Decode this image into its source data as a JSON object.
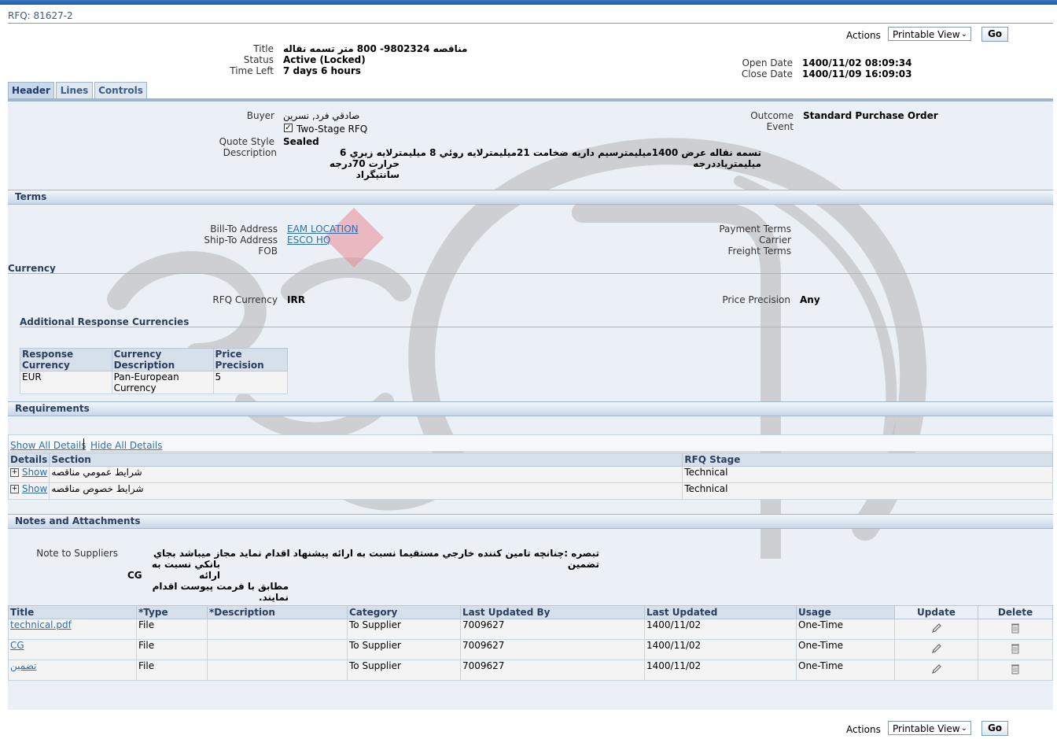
{
  "rfq_title": "RFQ: 81627-2",
  "actions": {
    "label": "Actions",
    "select_value": "Printable View",
    "go_label": "Go"
  },
  "summary": {
    "title_label": "Title",
    "title_value": "مناقصه 9802324- 800 متر تسمه نقاله",
    "status_label": "Status",
    "status_value": "Active (Locked)",
    "time_left_label": "Time Left",
    "time_left_value": "7 days 6 hours",
    "open_date_label": "Open Date",
    "open_date_value": "1400/11/02 08:09:34",
    "close_date_label": "Close Date",
    "close_date_value": "1400/11/09 16:09:03"
  },
  "tabs": [
    "Header",
    "Lines",
    "Controls"
  ],
  "header": {
    "buyer_label": "Buyer",
    "buyer_value": "صادقي فرد, نسرين",
    "two_stage_label": "Two-Stage RFQ",
    "quote_style_label": "Quote Style",
    "quote_style_value": "Sealed",
    "description_label": "Description",
    "description_line1": "تسمه نقاله عرض 1400ميليمترسيم داريه ضخامت 21ميليمترلايه روئي 8 ميليمترلايه زيري 6 ميليمترياددرجه",
    "description_line2": "حرارت 70درجه سانتيگراد",
    "outcome_label": "Outcome",
    "outcome_value": "Standard Purchase Order",
    "event_label": "Event"
  },
  "terms": {
    "section_title": "Terms",
    "bill_to_label": "Bill-To Address",
    "bill_to_value": "EAM LOCATION",
    "ship_to_label": "Ship-To Address",
    "ship_to_value": "ESCO HQ",
    "fob_label": "FOB",
    "payment_terms_label": "Payment Terms",
    "carrier_label": "Carrier",
    "freight_terms_label": "Freight Terms"
  },
  "currency": {
    "section_title": "Currency",
    "rfq_currency_label": "RFQ Currency",
    "rfq_currency_value": "IRR",
    "price_precision_label": "Price Precision",
    "price_precision_value": "Any",
    "additional_title": "Additional Response Currencies",
    "columns": [
      "Response Currency",
      "Currency Description",
      "Price Precision"
    ],
    "rows": [
      [
        "EUR",
        "Pan-European Currency",
        "5"
      ]
    ]
  },
  "requirements": {
    "section_title": "Requirements",
    "show_all": "Show All Details",
    "hide_all": "Hide All Details",
    "columns": [
      "Details",
      "Section",
      "RFQ Stage"
    ],
    "rows": [
      {
        "show": "Show",
        "section": "شرايط عمومي مناقصه",
        "stage": "Technical"
      },
      {
        "show": "Show",
        "section": "شرايط خصوص مناقصه",
        "stage": "Technical"
      }
    ]
  },
  "notes": {
    "section_title": "Notes and Attachments",
    "note_label": "Note to Suppliers",
    "note_line1": "تبصره :چنانچه تامين كننده خارجي مستقيما نسبت به ارائه پيشنهاد اقدام نمايد مجاز ميباشد بجاي تضمين",
    "note_line2": "بانكي نسبت به ارائه",
    "note_line3": "CG",
    "note_line4": "مطابق با فرمت پيوست اقدام نمايند.",
    "columns": [
      "Title",
      "*Type",
      "*Description",
      "Category",
      "Last Updated By",
      "Last Updated",
      "Usage",
      "Update",
      "Delete"
    ],
    "rows": [
      {
        "title": "technical.pdf",
        "type": "File",
        "description": "",
        "category": "To Supplier",
        "updated_by": "7009627",
        "updated": "1400/11/02",
        "usage": "One-Time"
      },
      {
        "title": "CG",
        "type": "File",
        "description": "",
        "category": "To Supplier",
        "updated_by": "7009627",
        "updated": "1400/11/02",
        "usage": "One-Time"
      },
      {
        "title": "تضمين",
        "type": "File",
        "description": "",
        "category": "To Supplier",
        "updated_by": "7009627",
        "updated": "1400/11/02",
        "usage": "One-Time"
      }
    ]
  },
  "icons": {
    "update": "pencil-icon",
    "delete": "trash-icon",
    "expand": "plus-box-icon"
  }
}
